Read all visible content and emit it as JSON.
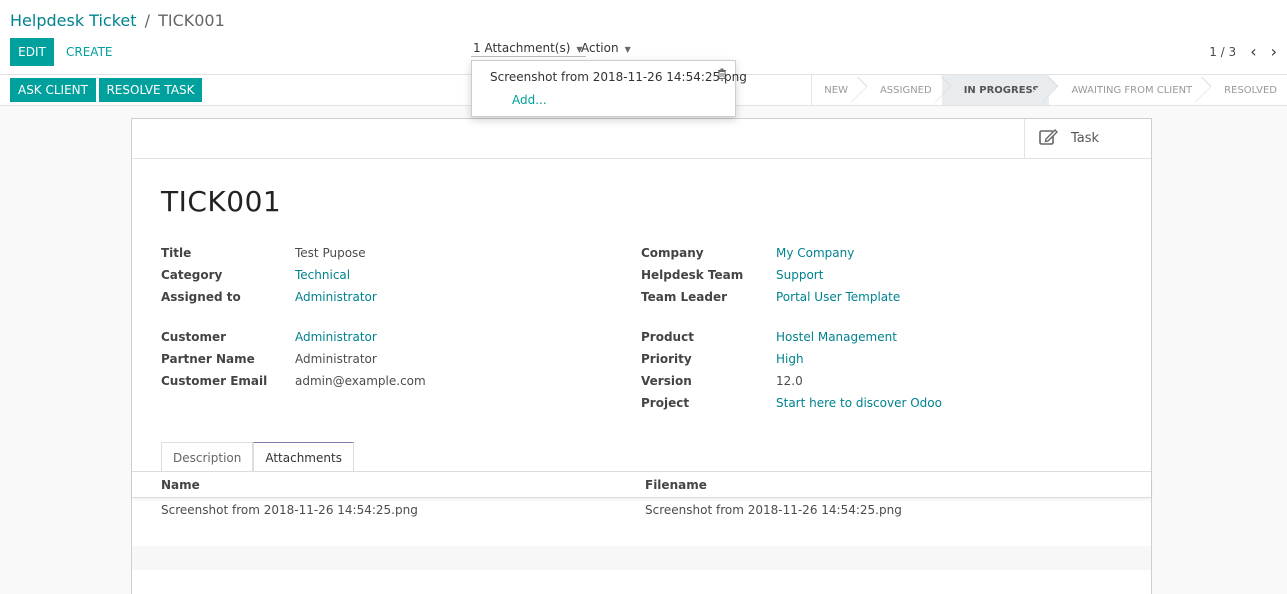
{
  "breadcrumb": {
    "parent": "Helpdesk Ticket",
    "separator": "/",
    "current": "TICK001"
  },
  "toolbar": {
    "edit_label": "EDIT",
    "create_label": "CREATE",
    "attachments_label": "1 Attachment(s)",
    "action_label": "Action"
  },
  "pager": {
    "value": "1 / 3"
  },
  "header_buttons": {
    "ask_client": "ASK CLIENT",
    "resolve_task": "RESOLVE TASK"
  },
  "statusbar": {
    "stages": [
      "NEW",
      "ASSIGNED",
      "IN PROGRESS",
      "AWAITING FROM CLIENT",
      "RESOLVED"
    ],
    "active": "IN PROGRESS"
  },
  "attachment_dropdown": {
    "file": "Screenshot from 2018-11-26 14:54:25.png",
    "add_label": "Add..."
  },
  "button_box": {
    "task_label": "Task"
  },
  "record": {
    "name": "TICK001",
    "left": [
      {
        "label": "Title",
        "value": "Test Pupose"
      },
      {
        "label": "Category",
        "value": "Technical"
      },
      {
        "label": "Assigned to",
        "value": "Administrator"
      },
      {
        "label": "Customer",
        "value": "Administrator"
      },
      {
        "label": "Partner Name",
        "value": "Administrator"
      },
      {
        "label": "Customer Email",
        "value": "admin@example.com"
      }
    ],
    "right": [
      {
        "label": "Company",
        "value": "My Company"
      },
      {
        "label": "Helpdesk Team",
        "value": "Support"
      },
      {
        "label": "Team Leader",
        "value": "Portal User Template"
      },
      {
        "label": "Product",
        "value": "Hostel Management"
      },
      {
        "label": "Priority",
        "value": "High"
      },
      {
        "label": "Version",
        "value": "12.0"
      },
      {
        "label": "Project",
        "value": "Start here to discover Odoo"
      }
    ]
  },
  "tabs": {
    "description": "Description",
    "attachments": "Attachments",
    "active": "Attachments"
  },
  "attachments_table": {
    "columns": [
      "Name",
      "Filename"
    ],
    "rows": [
      [
        "Screenshot from 2018-11-26 14:54:25.png",
        "Screenshot from 2018-11-26 14:54:25.png"
      ]
    ]
  },
  "colors": {
    "primary": "#00a09d",
    "link": "#00838f",
    "tab_accent": "#7c7bad"
  }
}
